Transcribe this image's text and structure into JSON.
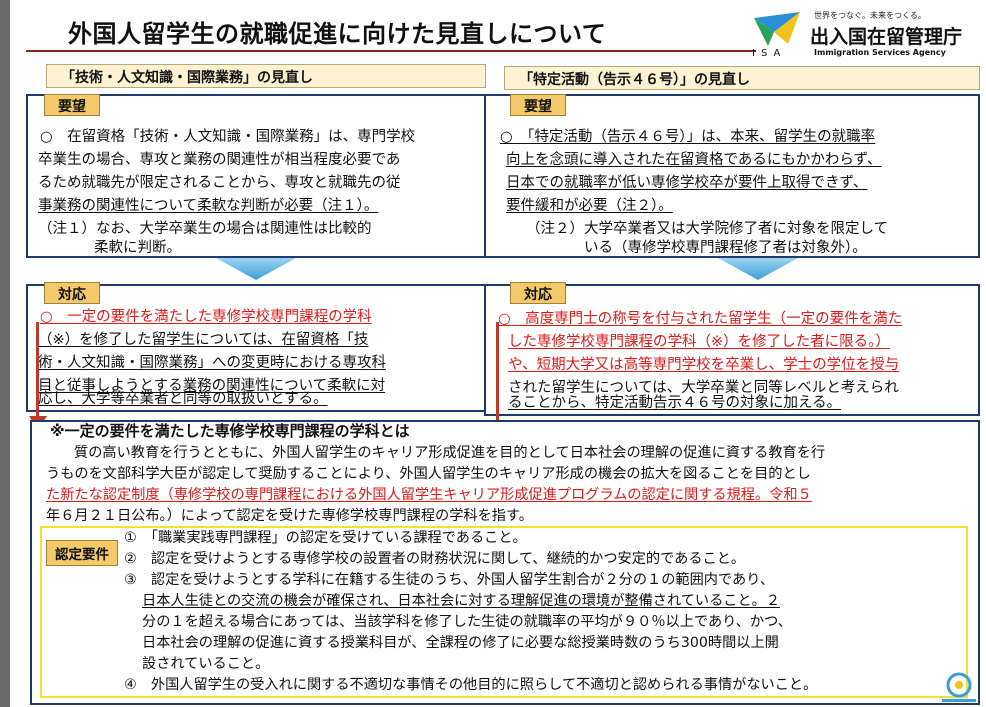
{
  "title": "外国人留学生の就職促進に向けた見直しについて",
  "logo": {
    "tagline": "世界をつなぐ。未来をつくる。",
    "name": "出入国在留管理庁",
    "english": "Immigration Services Agency",
    "abbr": "ISA"
  },
  "left": {
    "header": "「技術・人文知識・国際業務」の見直し",
    "request_tag": "要望",
    "request_lines": [
      "○　在留資格「技術・人文知識・国際業務」は、専門学校",
      "卒業生の場合、専攻と業務の関連性が相当程度必要であ",
      "るため就職先が限定されることから、専攻と就職先の従",
      "事業務の関連性について柔軟な判断が必要（注１）。",
      "（注１）なお、大学卒業生の場合は関連性は比較的",
      "柔軟に判断。"
    ],
    "response_tag": "対応",
    "response_lines": [
      "○　一定の要件を満たした専修学校専門課程の学科",
      "（※）を修了した留学生については、在留資格「技",
      "術・人文知識・国際業務」への変更時における専攻科",
      "目と従事しようとする業務の関連性について柔軟に対",
      "応し、大学等卒業者と同等の取扱いとする。"
    ]
  },
  "right": {
    "header": "「特定活動（告示４６号）」の見直し",
    "request_tag": "要望",
    "request_lines": [
      "○　「特定活動（告示４６号）」は、本来、留学生の就職率",
      "向上を念頭に導入された在留資格であるにもかかわらず、",
      "日本での就職率が低い専修学校卒が要件上取得できず、",
      "要件緩和が必要（注２）。",
      "（注２）大学卒業者又は大学院修了者に対象を限定して",
      "いる（専修学校専門課程修了者は対象外）。"
    ],
    "response_tag": "対応",
    "response_lines": [
      "○　高度専門士の称号を付与された留学生（一定の要件を満た",
      "した専修学校専門課程の学科（※）を修了した者に限る。）",
      "や、短期大学又は高等専門学校を卒業し、学士の学位を授与",
      "された留学生については、大学卒業と同等レベルと考えられ",
      "ることから、特定活動告示４６号の対象に加える。"
    ]
  },
  "note": {
    "heading": "※一定の要件を満たした専修学校専門課程の学科とは",
    "lines": [
      "質の高い教育を行うとともに、外国人留学生のキャリア形成促進を目的として日本社会の理解の促進に資する教育を行",
      "うものを文部科学大臣が認定して奨励することにより、外国人留学生のキャリア形成の機会の拡大を図ることを目的とし",
      "た新たな認定制度（専修学校の専門課程における外国人留学生キャリア形成促進プログラムの認定に関する規程。令和５",
      "年６月２１日公布。）によって認定を受けた専修学校専門課程の学科を指す。"
    ]
  },
  "requirements": {
    "tag": "認定要件",
    "items": [
      "①　「職業実践専門課程」の認定を受けている課程であること。",
      "②　認定を受けようとする専修学校の設置者の財務状況に関して、継続的かつ安定的であること。",
      "③　認定を受けようとする学科に在籍する生徒のうち、外国人留学生割合が２分の１の範囲内であり、",
      "日本人生徒との交流の機会が確保され、日本社会に対する理解促進の環境が整備されていること。２",
      "分の１を超える場合にあっては、当該学科を修了した生徒の就職率の平均が９０％以上であり、かつ、",
      "日本社会の理解の促進に資する授業科目が、全課程の修了に必要な総授業時数のうち300時間以上開",
      "設されていること。",
      "④　外国人留学生の受入れに関する不適切な事情その他目的に照らして不適切と認められる事情がないこと。"
    ]
  },
  "colors": {
    "accent_red": "#e01a1a",
    "box_border": "#1f3b6e",
    "tag_fill": "#f3c96a",
    "arrow_blue": "#5ab4df"
  }
}
